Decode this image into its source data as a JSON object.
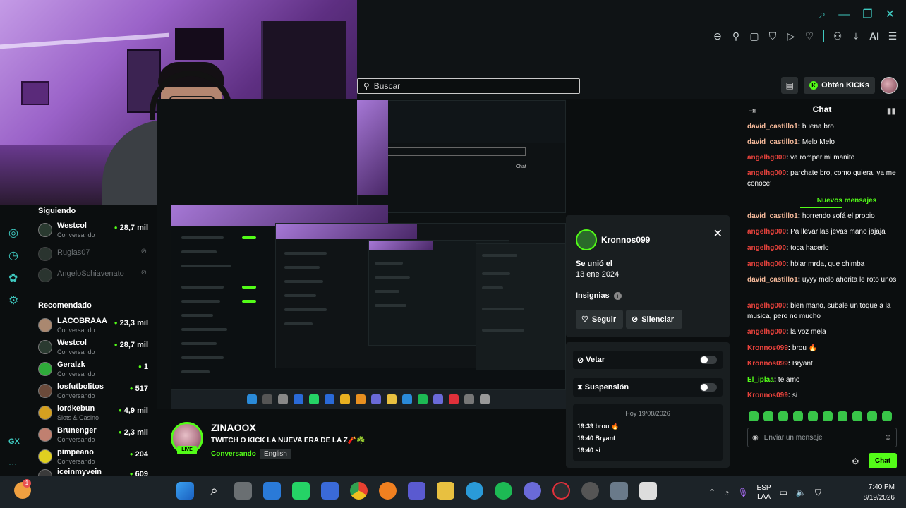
{
  "header": {
    "search_placeholder": "Buscar",
    "ai_label": "AI",
    "kicks_label": "Obtén KICKs"
  },
  "sidebar": {
    "following_title": "Siguiendo",
    "following": [
      {
        "name": "Westcol",
        "category": "Conversando",
        "viewers": "28,7 mil",
        "online": true
      },
      {
        "name": "Ruglas07",
        "category": "",
        "viewers": "",
        "online": false
      },
      {
        "name": "AngeloSchiavenato",
        "category": "",
        "viewers": "",
        "online": false
      }
    ],
    "recommended_title": "Recomendado",
    "recommended": [
      {
        "name": "LACOBRAAA",
        "category": "Conversando",
        "viewers": "23,3 mil"
      },
      {
        "name": "Westcol",
        "category": "Conversando",
        "viewers": "28,7 mil"
      },
      {
        "name": "Geralzk",
        "category": "Conversando",
        "viewers": "1"
      },
      {
        "name": "losfutbolitos",
        "category": "Conversando",
        "viewers": "517"
      },
      {
        "name": "lordkebun",
        "category": "Slots & Casino",
        "viewers": "4,9 mil"
      },
      {
        "name": "Brunenger",
        "category": "Conversando",
        "viewers": "2,3 mil"
      },
      {
        "name": "pimpeano",
        "category": "Conversando",
        "viewers": "204"
      },
      {
        "name": "iceinmyvein",
        "category": "",
        "viewers": "609"
      }
    ]
  },
  "stream": {
    "channel": "ZINAOOX",
    "title": "TWITCH O KICK LA NUEVA ERA DE LA Z🧨☘️",
    "category": "Conversando",
    "language": "English",
    "live_badge": "LIVE"
  },
  "user_card": {
    "username": "Kronnos099",
    "joined_label": "Se unió el",
    "joined_date": "13 ene 2024",
    "badges_label": "Insignias",
    "follow_label": "Seguir",
    "mute_label": "Silenciar",
    "ban_label": "Vetar",
    "timeout_label": "Suspensión",
    "log_day": "Hoy 19/08/2026",
    "log_messages": [
      "19:39 brou 🔥",
      "19:40 Bryant",
      "19:40 si"
    ]
  },
  "chat": {
    "title": "Chat",
    "new_messages_label": "Nuevos mensajes",
    "messages": [
      {
        "user": "david_castillo1",
        "text": "buena bro",
        "color": "#f5b99a"
      },
      {
        "user": "david_castillo1",
        "text": "Melo Melo",
        "color": "#f5b99a"
      },
      {
        "user": "angelhg000",
        "text": "va romper mi manito",
        "color": "#e8423c"
      },
      {
        "user": "angelhg000",
        "text": "parchate bro, como quiera, ya me conoce'",
        "color": "#e8423c"
      },
      {
        "user": "david_castillo1",
        "text": "horrendo sofá el propio",
        "color": "#f5b99a"
      },
      {
        "user": "angelhg000",
        "text": "Pa llevar las jevas mano jajaja",
        "color": "#e8423c"
      },
      {
        "user": "angelhg000",
        "text": "toca hacerlo",
        "color": "#e8423c"
      },
      {
        "user": "angelhg000",
        "text": "hblar mrda, que chimba",
        "color": "#e8423c"
      },
      {
        "user": "david_castillo1",
        "text": "uyyy melo ahorita le roto unos",
        "color": "#f5b99a"
      },
      {
        "user": "angelhg000",
        "text": "bien mano, subale un toque a la musica, pero no mucho",
        "color": "#e8423c"
      },
      {
        "user": "angelhg000",
        "text": "la voz mela",
        "color": "#e8423c"
      },
      {
        "user": "Kronnos099",
        "text": "brou 🔥",
        "color": "#e8423c"
      },
      {
        "user": "Kronnos099",
        "text": "Bryant",
        "color": "#e8423c"
      },
      {
        "user": "El_iplaa",
        "text": "te amo",
        "color": "#53fc18"
      },
      {
        "user": "Kronnos099",
        "text": "si",
        "color": "#e8423c"
      }
    ],
    "input_placeholder": "Enviar un mensaje",
    "send_label": "Chat"
  },
  "taskbar": {
    "notification_count": "1",
    "lang_line1": "ESP",
    "lang_line2": "LAA",
    "time": "7:40 PM",
    "date": "8/19/2026"
  }
}
